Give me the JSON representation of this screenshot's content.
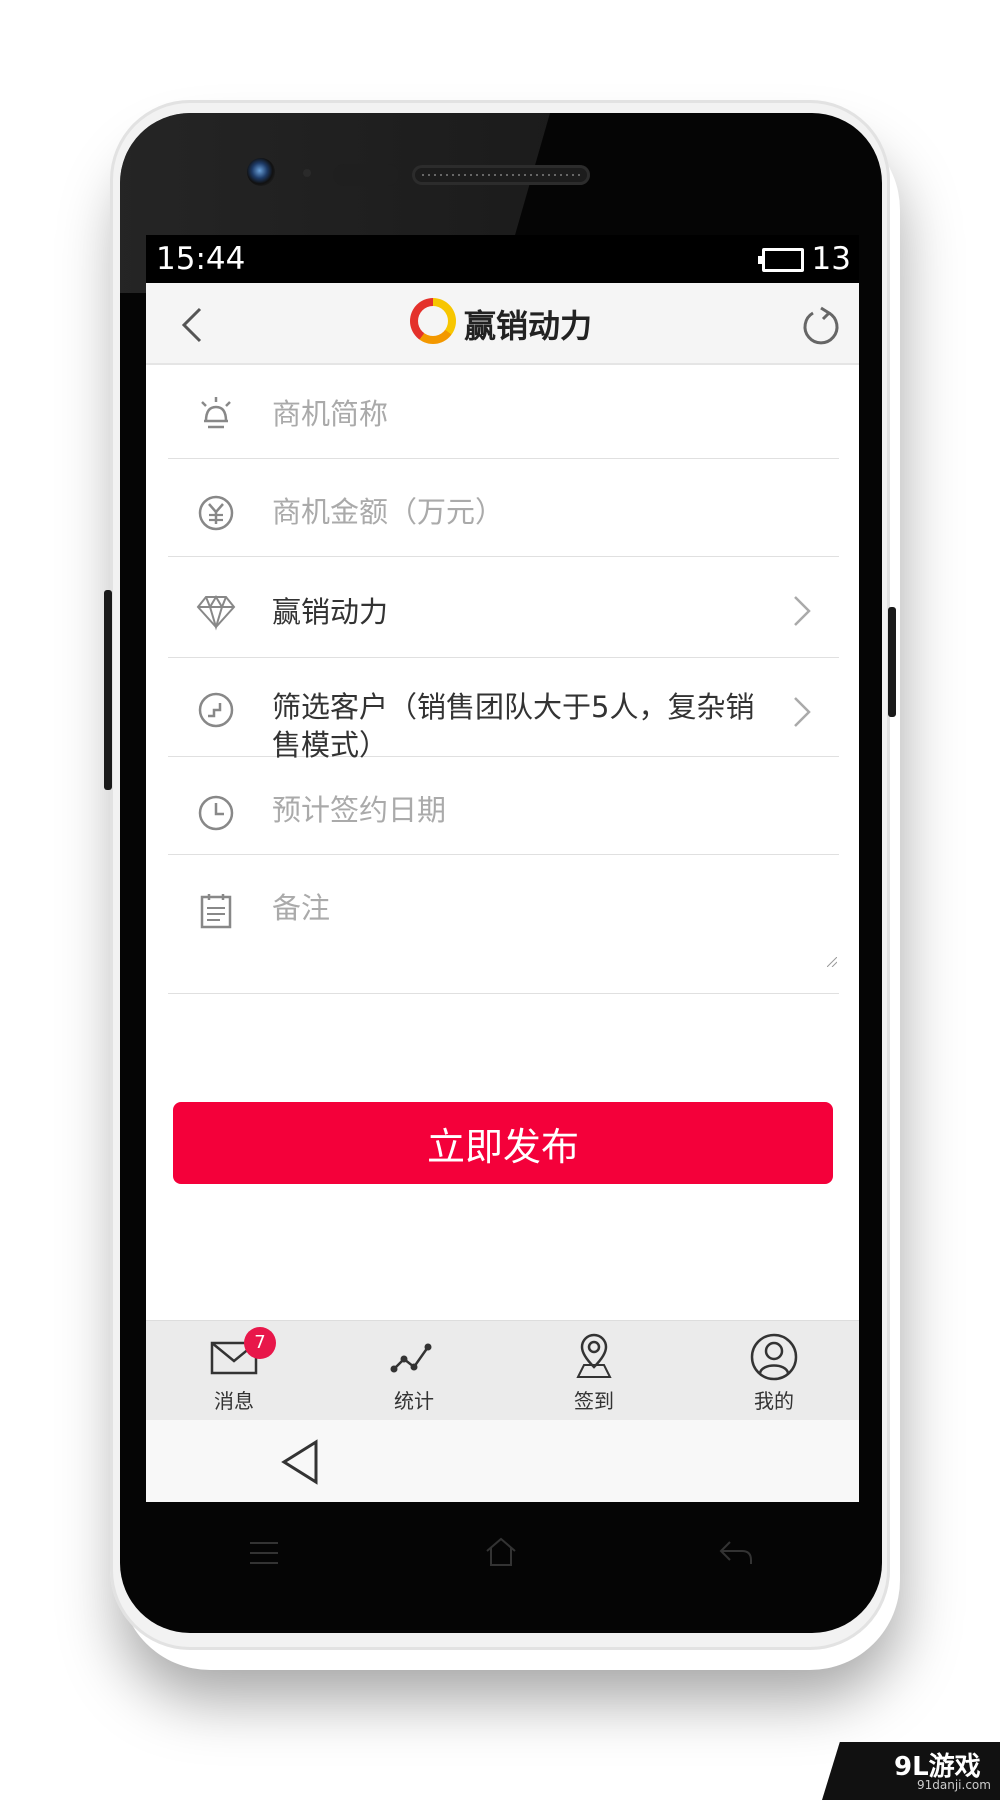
{
  "status_bar": {
    "time": "15:44",
    "battery": "13"
  },
  "header": {
    "title": "赢销动力",
    "logo": "ring-logo",
    "back_icon": "chevron-left-icon",
    "refresh_icon": "refresh-icon"
  },
  "form": {
    "fields": [
      {
        "icon": "bulb-icon",
        "placeholder": "商机简称"
      },
      {
        "icon": "yen-icon",
        "placeholder": "商机金额（万元）"
      },
      {
        "icon": "diamond-icon",
        "value": "赢销动力"
      },
      {
        "icon": "stairs-icon",
        "value": "筛选客户（销售团队大于5人，复杂销售模式）"
      },
      {
        "icon": "clock-icon",
        "placeholder": "预计签约日期"
      },
      {
        "icon": "notepad-icon",
        "placeholder": "备注"
      }
    ],
    "publish_label": "立即发布",
    "accent_color": "#f4003a"
  },
  "tabbar": {
    "tabs": [
      {
        "label": "消息",
        "icon": "mail-icon",
        "badge": "7"
      },
      {
        "label": "统计",
        "icon": "chart-icon"
      },
      {
        "label": "签到",
        "icon": "location-icon"
      },
      {
        "label": "我的",
        "icon": "user-icon"
      }
    ]
  },
  "watermark": {
    "brand": "9L游戏",
    "url": "91danji.com"
  }
}
